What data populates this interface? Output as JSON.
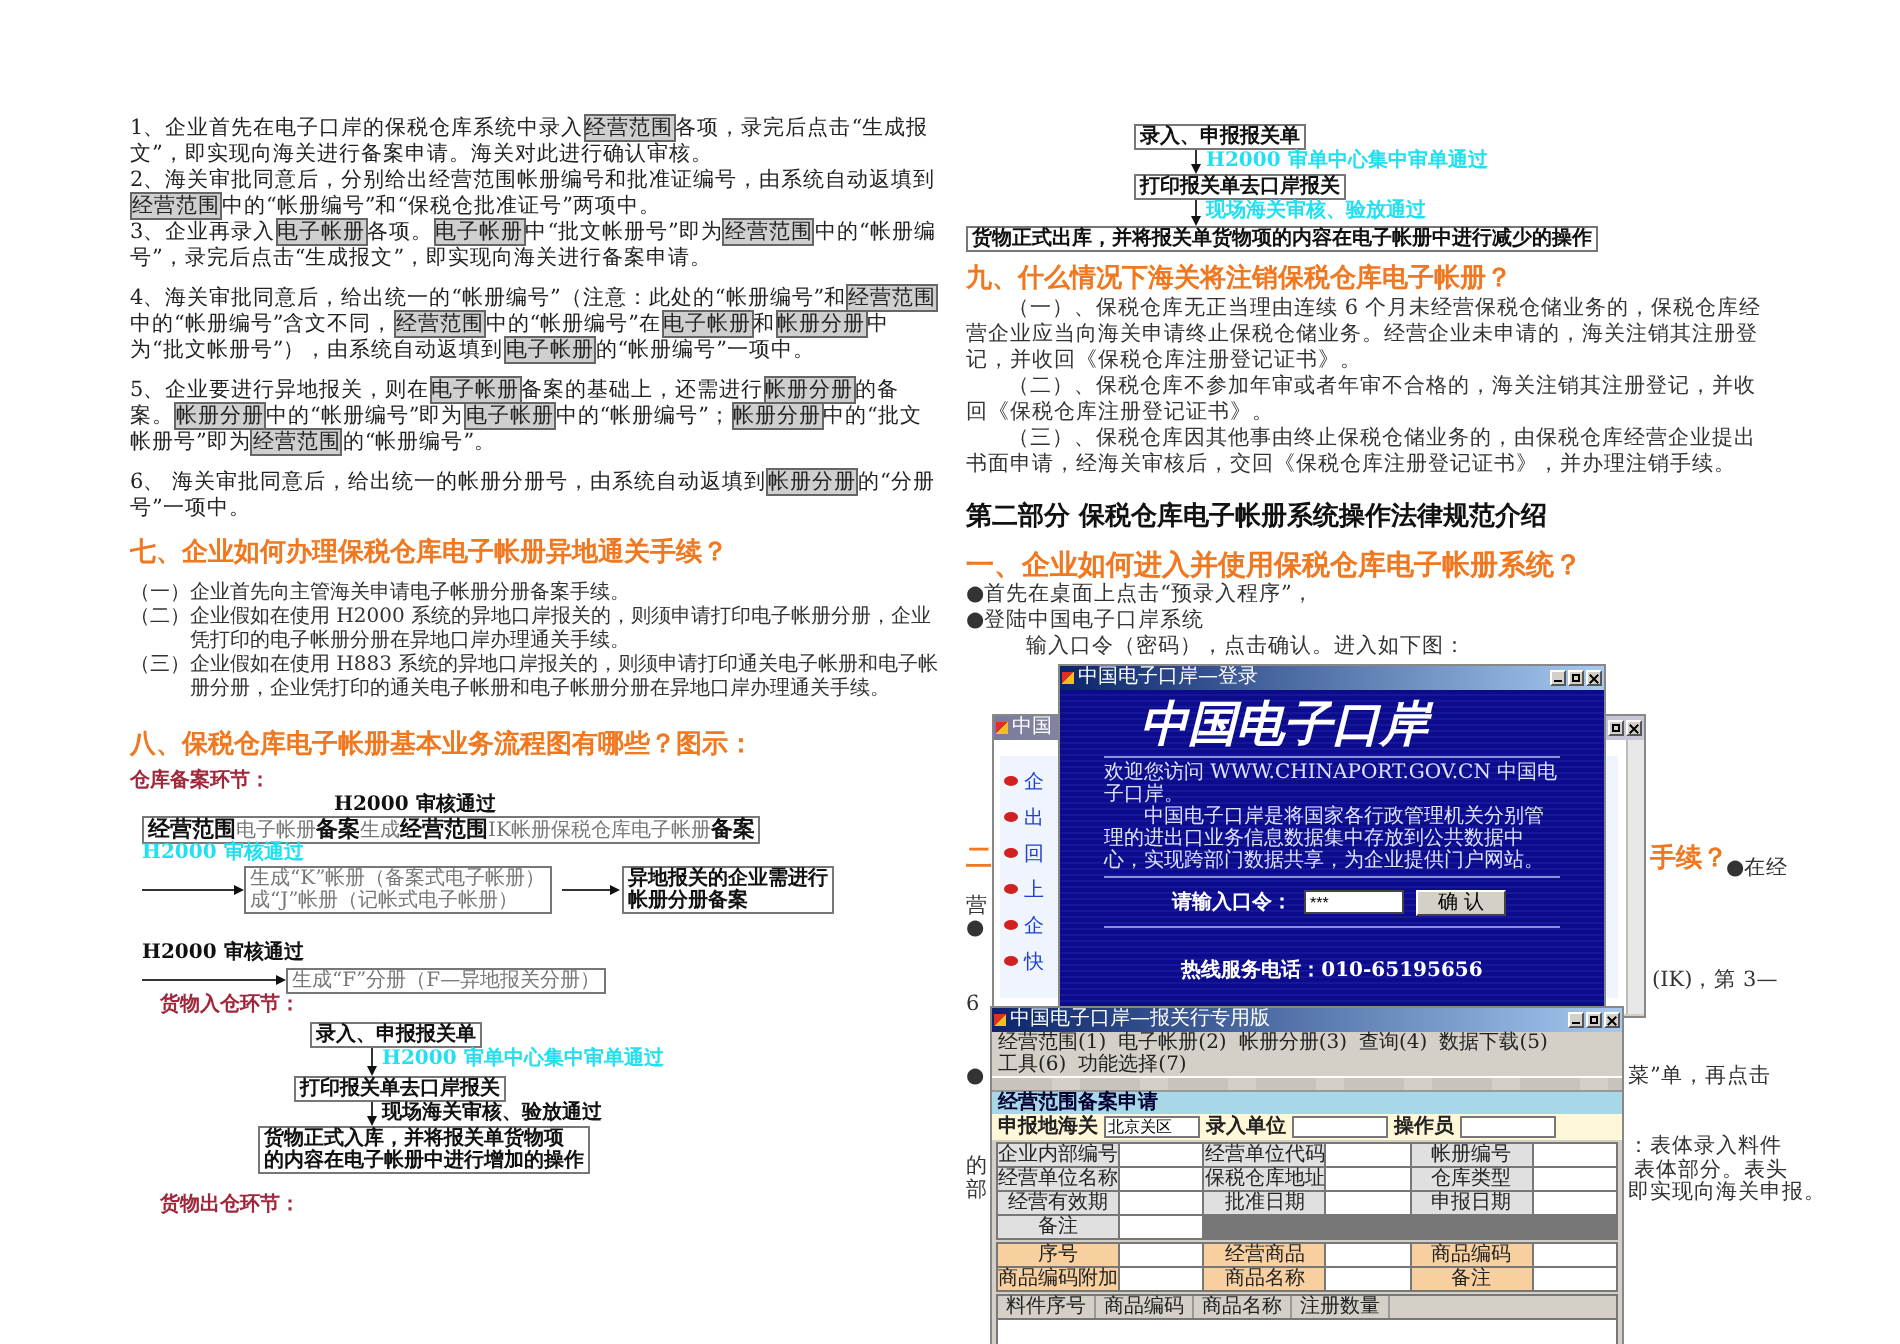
{
  "steps": [
    {
      "parts": [
        {
          "text": "1、企业首先在电子口岸的保税仓库系统中录入",
          "highlighted": false
        },
        {
          "text": "经营范围",
          "highlighted": true
        },
        {
          "text": "各项，录完后点击“生成报文”，即实现向海关进行备案申请。海关对此进行确认审核。",
          "highlighted": false
        }
      ]
    },
    {
      "parts": [
        {
          "text": "2、海关审批同意后，分别给出经营范围帐册编号和批准证编号，由系统自动返填到",
          "highlighted": false
        },
        {
          "text": "经营范围",
          "highlighted": true
        },
        {
          "text": "中的“帐册编号”和“保税仓批准证号”两项中。",
          "highlighted": false
        }
      ]
    },
    {
      "parts": [
        {
          "text": "3、企业再录入",
          "highlighted": false
        },
        {
          "text": "电子帐册",
          "highlighted": true
        },
        {
          "text": "各项。",
          "highlighted": false
        },
        {
          "text": "电子帐册",
          "highlighted": true
        },
        {
          "text": "中“批文帐册号”即为",
          "highlighted": false
        },
        {
          "text": "经营范围",
          "highlighted": true
        },
        {
          "text": "中的“帐册编号”，录完后点击“生成报文”，即实现向海关进行备案申请。",
          "highlighted": false
        }
      ]
    },
    {
      "parts": [
        {
          "text": "4、海关审批同意后，给出统一的“帐册编号”（注意：此处的“帐册编号”和",
          "highlighted": false
        },
        {
          "text": "经营范围",
          "highlighted": true
        },
        {
          "text": "中的“帐册编号”含文不同，",
          "highlighted": false
        },
        {
          "text": "经营范围",
          "highlighted": true
        },
        {
          "text": "中的“帐册编号”在",
          "highlighted": false
        },
        {
          "text": "电子帐册",
          "highlighted": true
        },
        {
          "text": "和",
          "highlighted": false
        },
        {
          "text": "帐册分册",
          "highlighted": true
        },
        {
          "text": "中为“批文帐册号”），由系统自动返填到",
          "highlighted": false
        },
        {
          "text": "电子帐册",
          "highlighted": true
        },
        {
          "text": "的“帐册编号”一项中。",
          "highlighted": false
        }
      ]
    },
    {
      "parts": [
        {
          "text": "5、企业要进行异地报关，则在",
          "highlighted": false
        },
        {
          "text": "电子帐册",
          "highlighted": true
        },
        {
          "text": "备案的基础上，还需进行",
          "highlighted": false
        },
        {
          "text": "帐册分册",
          "highlighted": true
        },
        {
          "text": "的备案。",
          "highlighted": false
        },
        {
          "text": "帐册分册",
          "highlighted": true
        },
        {
          "text": "中的“帐册编号”即为",
          "highlighted": false
        },
        {
          "text": "电子帐册",
          "highlighted": true
        },
        {
          "text": "中的“帐册编号”；",
          "highlighted": false
        },
        {
          "text": "帐册分册",
          "highlighted": true
        },
        {
          "text": "中的“批文帐册号”即为",
          "highlighted": false
        },
        {
          "text": "经营范围",
          "highlighted": true
        },
        {
          "text": "的“帐册编号”。",
          "highlighted": false
        }
      ]
    },
    {
      "parts": [
        {
          "text": "6、 海关审批同意后，给出统一的帐册分册号，由系统自动返填到",
          "highlighted": false
        },
        {
          "text": "帐册分册",
          "highlighted": true
        },
        {
          "text": "的“分册号”一项中。",
          "highlighted": false
        }
      ]
    }
  ],
  "section_7": {
    "heading": "七、企业如何办理保税仓库电子帐册异地通关手续？",
    "items": [
      {
        "marker": "（一）",
        "text": "企业首先向主管海关申请电子帐册分册备案手续。"
      },
      {
        "marker": "（二）",
        "text": "企业假如在使用 H2000 系统的异地口岸报关的，则须申请打印电子帐册分册，企业凭打印的电子帐册分册在异地口岸办理通关手续。"
      },
      {
        "marker": "（三）",
        "text": "企业假如在使用 H883 系统的异地口岸报关的，则须申请打印通关电子帐册和电子帐册分册，企业凭打印的通关电子帐册和电子帐册分册在异地口岸办理通关手续。"
      }
    ]
  },
  "section_8": {
    "heading": "八、保税仓库电子帐册基本业务流程图有哪些？图示："
  },
  "flowcharts": [
    {
      "stage": "仓库备案环节：",
      "nodes": [
        {
          "kind": "label",
          "color": "#111111",
          "lines": [
            "H2000 审核通过"
          ]
        },
        {
          "kind": "mixed",
          "parts": [
            {
              "text": "经营范围",
              "emphasis": true
            },
            {
              "text": "电子帐册",
              "emphasis": false
            },
            {
              "text": "备案",
              "emphasis": true
            },
            {
              "text": "生成",
              "emphasis": false
            },
            {
              "text": "经营范围",
              "emphasis": true
            },
            {
              "text": "IK帐册保税仓库电子帐册",
              "emphasis": false
            },
            {
              "text": "备案",
              "emphasis": true
            }
          ]
        },
        {
          "kind": "label",
          "color": "#22e0f0",
          "lines": [
            "H2000 审核通过"
          ]
        },
        {
          "kind": "box",
          "color": "#777777",
          "lines": [
            "生成“K”帐册（备案式电子帐册）",
            "成“J”帐册（记帐式电子帐册）"
          ]
        },
        {
          "kind": "box",
          "color": "#111111",
          "lines": [
            "异地报关的企业需进行",
            "帐册分册备案"
          ]
        },
        {
          "kind": "label",
          "color": "#111111",
          "lines": [
            "H2000 审核通过"
          ]
        },
        {
          "kind": "box",
          "color": "#777777",
          "lines": [
            "生成“F”分册（F—异地报关分册）"
          ]
        }
      ]
    },
    {
      "stage": "货物入仓环节：",
      "nodes": [
        {
          "kind": "box",
          "color": "#111111",
          "lines": [
            "录入、申报报关单"
          ]
        },
        {
          "kind": "label",
          "color": "#22e0f0",
          "lines": [
            "H2000 审单中心集中审单通过"
          ]
        },
        {
          "kind": "box",
          "color": "#111111",
          "lines": [
            "打印报关单去口岸报关"
          ]
        },
        {
          "kind": "label",
          "color": "#111111",
          "lines": [
            "现场海关审核、验放通过"
          ]
        },
        {
          "kind": "box",
          "color": "#111111",
          "lines": [
            "货物正式入库，并将报关单货物项",
            "的内容在电子帐册中进行增加的操作"
          ]
        }
      ]
    },
    {
      "stage": "货物出仓环节：",
      "nodes": [
        {
          "kind": "box",
          "color": "#111111",
          "lines": [
            "录入、申报报关单"
          ]
        },
        {
          "kind": "label",
          "color": "#22e0f0",
          "lines": [
            "H2000 审单中心集中审单通过"
          ]
        },
        {
          "kind": "box",
          "color": "#111111",
          "lines": [
            "打印报关单去口岸报关"
          ]
        },
        {
          "kind": "label",
          "color": "#22e0f0",
          "lines": [
            "现场海关审核、验放通过"
          ]
        },
        {
          "kind": "box",
          "color": "#111111",
          "lines": [
            "货物正式出库，并将报关单货物项的内容在电子帐册中进行减少的操作"
          ]
        }
      ]
    }
  ],
  "section_9": {
    "heading": "九、什么情况下海关将注销保税仓库电子帐册？",
    "paragraphs": [
      "（一）、保税仓库无正当理由连续 6 个月未经营保税仓储业务的，保税仓库经营企业应当向海关申请终止保税仓储业务。经营企业未申请的，海关注销其注册登记，并收回《保税仓库注册登记证书》。",
      "（二）、保税仓库不参加年审或者年审不合格的，海关注销其注册登记，并收回《保税仓库注册登记证书》。",
      "（三）、保税仓库因其他事由终止保税仓储业务的，由保税仓库经营企业提出书面申请，经海关审核后，交回《保税仓库注册登记证书》，并办理注销手续。"
    ]
  },
  "part_2": {
    "heading": "第二部分  保税仓库电子帐册系统操作法律规范介绍",
    "section_1": {
      "heading": "一、企业如何进入并使用保税仓库电子帐册系统？",
      "bullets": [
        "●首先在桌面上点击“预录入程序”，",
        "●登陆中国电子口岸系统"
      ],
      "note": "输入口令（密码），点击确认。进入如下图："
    }
  },
  "background_fragments": [
    {
      "color": "#f07820",
      "text": "二"
    },
    {
      "color": "#f07820",
      "text": "手续？"
    },
    {
      "color": "#333333",
      "text": "●在经"
    },
    {
      "color": "#333333",
      "text": "营"
    },
    {
      "color": "#333333",
      "text": "●"
    },
    {
      "color": "#333333",
      "text": "(IK)，第 3—"
    },
    {
      "color": "#333333",
      "text": "6"
    },
    {
      "color": "#333333",
      "text": "●"
    },
    {
      "color": "#333333",
      "text": "菜”单，再点击"
    },
    {
      "color": "#333333",
      "text": "：表体录入料件"
    },
    {
      "color": "#333333",
      "text": "的"
    },
    {
      "color": "#333333",
      "text": "表体部分。表头"
    },
    {
      "color": "#333333",
      "text": "部"
    },
    {
      "color": "#333333",
      "text": "即实现向海关申报。"
    }
  ],
  "browser_window": {
    "title": "中国",
    "links": [
      "企",
      "出",
      "回",
      "上",
      "企",
      "快"
    ]
  },
  "login_window": {
    "title": "中国电子口岸—登录",
    "logo": "中国电子口岸",
    "welcome": "欢迎您访问 WWW.CHINAPORT.GOV.CN 中国电子口岸。",
    "intro": "中国电子口岸是将国家各行政管理机关分别管理的进出口业务信息数据集中存放到公共数据中心，实现跨部门数据共享，为企业提供门户网站。",
    "password_label": "请输入口令：",
    "password_value": "***",
    "confirm_button": "确 认",
    "hotline": "热线服务电话：010-65195656"
  },
  "app_window": {
    "title": "中国电子口岸—报关行专用版",
    "menu": [
      "经营范围(1)",
      "电子帐册(2)",
      "帐册分册(3)",
      "查询(4)",
      "数据下载(5)",
      "工具(6)",
      "功能选择(7)"
    ],
    "form_title": "经营范围备案申请",
    "header_fields": [
      {
        "label": "申报地海关",
        "value": "北京关区"
      },
      {
        "label": "录入单位"
      },
      {
        "label": "操作员"
      }
    ],
    "grid_labels": [
      "企业内部编号",
      "经营单位代码",
      "帐册编号",
      "经营单位名称",
      "保税仓库地址",
      "仓库类型",
      "经营有效期",
      "批准日期",
      "申报日期",
      "备注"
    ],
    "item_labels": [
      "序号",
      "经营商品",
      "商品编码",
      "商品编码附加",
      "商品名称",
      "备注"
    ],
    "table_columns": [
      "料件序号",
      "商品编码",
      "商品名称",
      "注册数量"
    ]
  }
}
